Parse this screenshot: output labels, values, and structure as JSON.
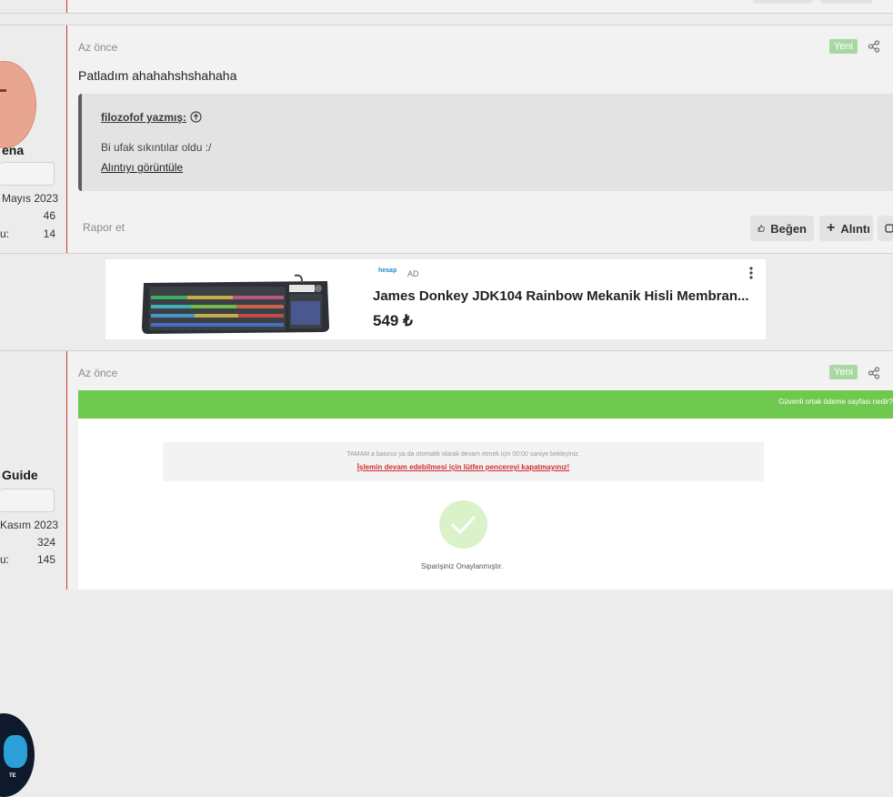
{
  "post1": {
    "time": "Az önce",
    "badge": "Yeni",
    "text": "Patladım ahahahshshahaha",
    "quote": {
      "author": "filozofof yazmış:",
      "text": "Bi ufak sıkıntılar oldu :/",
      "view_link": "Alıntıyı görüntüle"
    },
    "report": "Rapor et",
    "like": "Beğen",
    "quote_btn": "Alıntı"
  },
  "user1": {
    "name": "ena",
    "joined": "Mayıs 2023",
    "messages": "46",
    "reactions_label": "u:",
    "reactions": "14"
  },
  "ad": {
    "brand": "hesap",
    "label": "AD",
    "title": "James Donkey JDK104 Rainbow Mekanik Hisli Membran...",
    "price": "549 ₺"
  },
  "post2": {
    "time": "Az önce",
    "badge": "Yeni",
    "embed": {
      "topbar": "Güvenli ortak ödeme sayfası nedir?",
      "info1": "TAMAM a basınız ya da otomatik olarak devam etmek için 00:00 saniye bekleyiniz.",
      "info2": "İşlemin devam edebilmesi için lütfen pencereyi kapatmayınız!",
      "status": "Siparişiniz Onaylanmıştır."
    }
  },
  "user2": {
    "name": "Guide",
    "joined": "Kasım 2023",
    "messages": "324",
    "reactions_label": "u:",
    "reactions": "145"
  },
  "colors": {
    "accent_red": "#c0392b",
    "badge_green": "#a8d8a2",
    "embed_green": "#70c94f"
  }
}
